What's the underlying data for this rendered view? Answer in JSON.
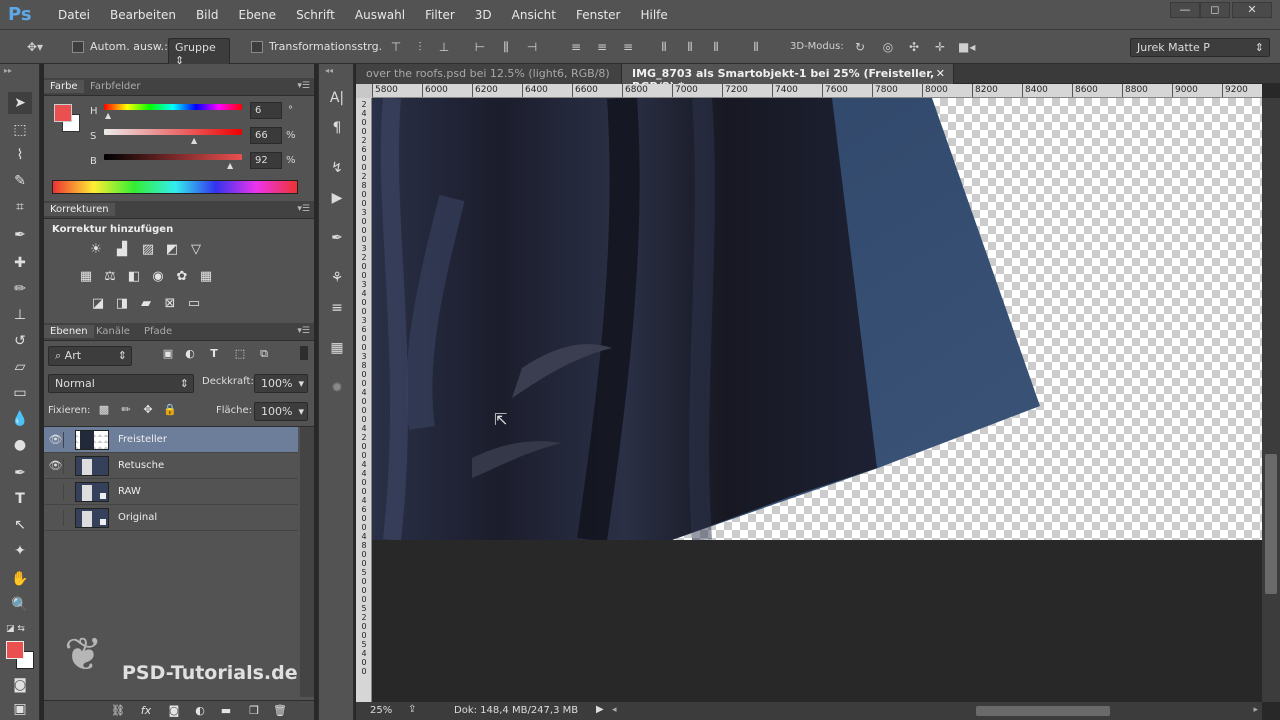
{
  "menubar": {
    "logo": "Ps",
    "items": [
      "Datei",
      "Bearbeiten",
      "Bild",
      "Ebene",
      "Schrift",
      "Auswahl",
      "Filter",
      "3D",
      "Ansicht",
      "Fenster",
      "Hilfe"
    ],
    "window_controls": [
      "—",
      "◻",
      "✕"
    ]
  },
  "options": {
    "auto_select_label": "Autom. ausw.:",
    "group_value": "Gruppe",
    "transform_label": "Transformationsstrg.",
    "mode_label": "3D-Modus:",
    "workspace": "Jurek Matte P"
  },
  "color_panel": {
    "tabs": [
      "Farbe",
      "Farbfelder"
    ],
    "rows": [
      {
        "label": "H",
        "value": "6",
        "unit": "°",
        "position": 0.02
      },
      {
        "label": "S",
        "value": "66",
        "unit": "%",
        "position": 0.66
      },
      {
        "label": "B",
        "value": "92",
        "unit": "%",
        "position": 0.92
      }
    ],
    "fg_color": "#eb5050",
    "bg_color": "#ffffff"
  },
  "adjustments_panel": {
    "tab": "Korrekturen",
    "heading": "Korrektur hinzufügen"
  },
  "layers_panel": {
    "tabs": [
      "Ebenen",
      "Kanäle",
      "Pfade"
    ],
    "filter_label": "Art",
    "blend_mode": "Normal",
    "opacity_label": "Deckkraft:",
    "opacity_value": "100%",
    "lock_label": "Fixieren:",
    "fill_label": "Fläche:",
    "fill_value": "100%",
    "layers": [
      {
        "name": "Freisteller",
        "visible": true,
        "selected": true
      },
      {
        "name": "Retusche",
        "visible": true,
        "selected": false
      },
      {
        "name": "RAW",
        "visible": false,
        "selected": false
      },
      {
        "name": "Original",
        "visible": false,
        "selected": false
      }
    ]
  },
  "document": {
    "tabs": [
      {
        "label": "over the roofs.psd bei 12.5% (light6, RGB/8)",
        "active": false
      },
      {
        "label": "IMG_8703 als Smartobjekt-1 bei 25% (Freisteller, RGB/8) *",
        "active": true
      }
    ],
    "ruler_h": [
      "5800",
      "6000",
      "6200",
      "6400",
      "6600",
      "6800",
      "7000",
      "7200",
      "7400",
      "7600",
      "7800",
      "8000",
      "8200",
      "8400",
      "8600",
      "8800",
      "9000",
      "9200"
    ],
    "ruler_v": [
      "2",
      "4",
      "0",
      "0",
      "2",
      "6",
      "0",
      "0",
      "2",
      "8",
      "0",
      "0",
      "3",
      "0",
      "0",
      "0",
      "3",
      "2",
      "0",
      "0",
      "3",
      "4",
      "0",
      "0",
      "3",
      "6",
      "0",
      "0",
      "3",
      "8",
      "0",
      "0",
      "4",
      "0",
      "0",
      "0",
      "4",
      "2",
      "0",
      "0",
      "4",
      "4",
      "0",
      "0",
      "4",
      "6",
      "0",
      "0",
      "4",
      "8",
      "0",
      "0",
      "5",
      "0",
      "0",
      "0",
      "5",
      "2",
      "0",
      "0",
      "5",
      "4",
      "0",
      "0"
    ]
  },
  "status": {
    "zoom": "25%",
    "doc_info": "Dok: 148,4 MB/247,3 MB"
  },
  "watermark": "PSD-Tutorials.de"
}
